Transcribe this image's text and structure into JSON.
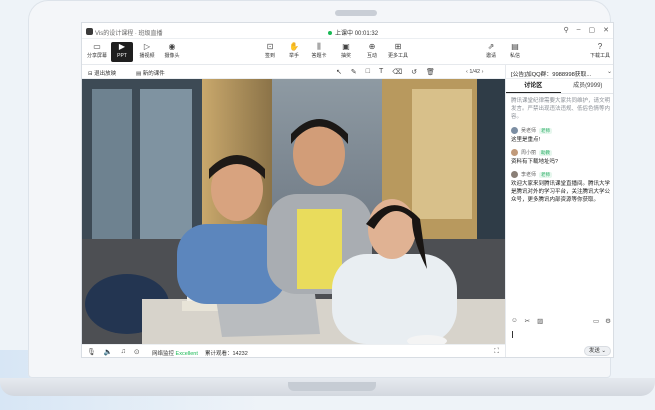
{
  "window": {
    "app_title": "Vis的设计课程 · 班级直播",
    "live_status": "上课中",
    "elapsed": "00:01:32",
    "controls": [
      "pin-icon",
      "minimize-icon",
      "maximize-icon",
      "close-icon"
    ]
  },
  "toolbar": {
    "left": [
      {
        "label": "分享屏幕",
        "icon": "screen-share-icon"
      },
      {
        "label": "PPT",
        "icon": "ppt-icon"
      },
      {
        "label": "播视频",
        "icon": "video-icon"
      },
      {
        "label": "摄像头",
        "icon": "camera-icon"
      }
    ],
    "center": [
      {
        "label": "签到",
        "icon": "sign-in-icon"
      },
      {
        "label": "举手",
        "icon": "hand-icon"
      },
      {
        "label": "答题卡",
        "icon": "quiz-icon"
      },
      {
        "label": "抽奖",
        "icon": "gift-icon"
      },
      {
        "label": "互动",
        "icon": "interact-icon"
      },
      {
        "label": "更多工具",
        "icon": "more-tools-icon"
      }
    ],
    "right": [
      {
        "label": "邀请",
        "icon": "share-icon"
      },
      {
        "label": "私信",
        "icon": "message-icon"
      },
      {
        "label": "下载工具",
        "icon": "help-icon"
      }
    ]
  },
  "subbar": {
    "exit_label": "退出放映",
    "courseware_label": "新的课件",
    "page": "1/42",
    "annotation_tools": [
      "cursor-icon",
      "pen-icon",
      "rectangle-icon",
      "text-icon",
      "eraser-icon",
      "undo-icon",
      "trash-icon"
    ]
  },
  "bottombar": {
    "icons": [
      "mic-icon",
      "speaker-icon",
      "music-icon",
      "location-icon"
    ],
    "network_label": "网络监控",
    "network_status": "Excellent",
    "views_label": "累计观看：14232",
    "fullscreen_icon": "fullscreen-icon"
  },
  "panel": {
    "notice": "[公告]加QQ群：9988998获取...",
    "tabs": [
      "讨论区",
      "成员(9999)"
    ],
    "system_message": "腾讯课堂纪律需要大家共同维护，请文明发言。严禁出现违法违规、低俗色情等内容。",
    "messages": [
      {
        "name": "吴老师",
        "role": "老师",
        "text": "这里是重点!"
      },
      {
        "name": "周小丽",
        "role": "助教",
        "text": "资料有下载地址吗?"
      },
      {
        "name": "李老师",
        "role": "老师",
        "text": "欢迎大家来到腾讯课堂直播间。腾讯大学是腾讯对外的学习平台，关注腾讯大学公众号，更多腾讯内部资源等你获取。"
      }
    ],
    "send_label": "发送"
  },
  "colors": {
    "accent": "#19b955",
    "toolbar_active": "#1f1f1f"
  }
}
